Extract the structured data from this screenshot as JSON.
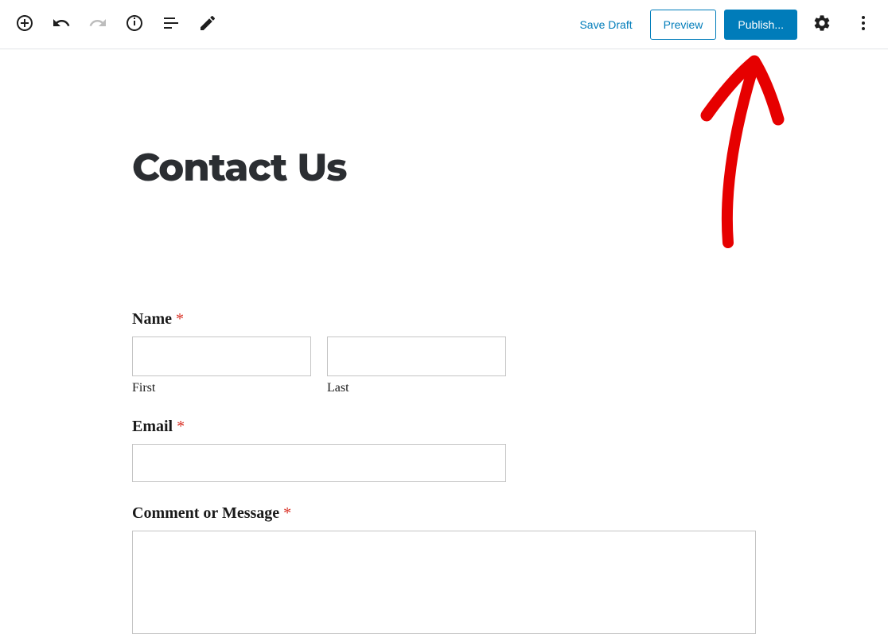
{
  "toolbar": {
    "save_draft": "Save Draft",
    "preview": "Preview",
    "publish": "Publish..."
  },
  "page": {
    "title": "Contact Us"
  },
  "form": {
    "name": {
      "label": "Name",
      "first_sublabel": "First",
      "last_sublabel": "Last",
      "first_value": "",
      "last_value": ""
    },
    "email": {
      "label": "Email",
      "value": ""
    },
    "message": {
      "label": "Comment or Message",
      "value": ""
    },
    "required_marker": "*"
  }
}
